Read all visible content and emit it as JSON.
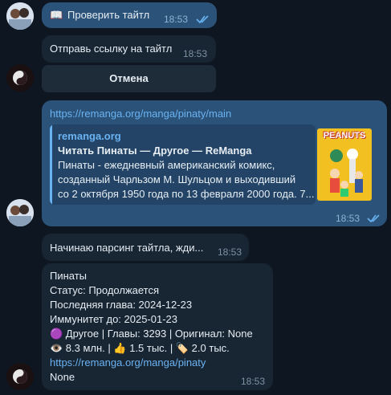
{
  "messages": {
    "m1": {
      "icon": "📖",
      "text": "Проверить тайтл",
      "time": "18:53"
    },
    "m2": {
      "text": "Отправь ссылку на тайтл",
      "time": "18:53"
    },
    "cancel_button": "Отмена",
    "m3": {
      "url": "https://remanga.org/manga/pinaty/main",
      "time": "18:53",
      "preview": {
        "site": "remanga.org",
        "title": "Читать Пинаты — Другое — ReManga",
        "desc_lines": [
          "Пинаты - ежедневный американский комикс,",
          "созданный Чарльзом М. Шульцом и выходивший",
          "со 2 октября 1950 года по 13 февраля 2000 года. 7..."
        ],
        "cover_text": "PEANUTS"
      }
    },
    "m4": {
      "text": "Начинаю парсинг тайтла, жди...",
      "time": "18:53"
    },
    "m5": {
      "time": "18:53",
      "lines": [
        "Пинаты",
        "Статус: Продолжается",
        "Последняя глава: 2024-12-23",
        "Иммунитет до: 2025-01-23",
        "🟣 Другое | Главы: 3293 | Оригинал: None",
        "👁️ 8.3 млн. | 👍 1.5 тыс. | 🏷️ 2.0 тыс."
      ],
      "link": "https://remanga.org/manga/pinaty",
      "last": "None"
    }
  },
  "colors": {
    "background": "#0e1621",
    "incoming": "#182533",
    "outgoing": "#2b5278",
    "link": "#6ab3f3"
  }
}
